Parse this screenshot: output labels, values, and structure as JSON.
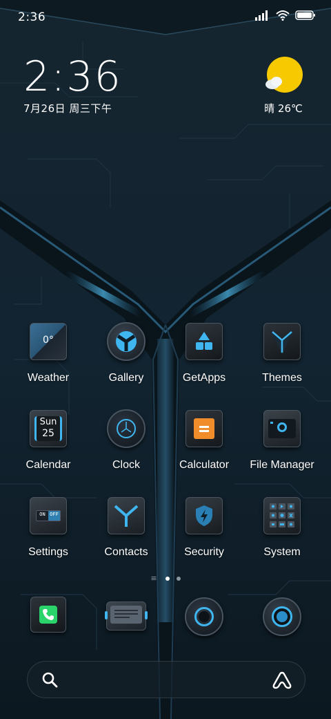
{
  "status_bar": {
    "time": "2:36",
    "icons": [
      "signal-icon",
      "wifi-icon",
      "battery-icon"
    ]
  },
  "clock_widget": {
    "time": "2:36",
    "date": "7月26日 周三下午"
  },
  "weather_widget": {
    "icon": "sun-cloud-icon",
    "text": "晴 26℃"
  },
  "apps": [
    {
      "label": "Weather",
      "icon": "weather-app-icon",
      "badge": "0°"
    },
    {
      "label": "Gallery",
      "icon": "gallery-app-icon"
    },
    {
      "label": "GetApps",
      "icon": "getapps-app-icon"
    },
    {
      "label": "Themes",
      "icon": "themes-app-icon"
    },
    {
      "label": "Calendar",
      "icon": "calendar-app-icon",
      "day_name": "Sun",
      "day_num": "25"
    },
    {
      "label": "Clock",
      "icon": "clock-app-icon"
    },
    {
      "label": "Calculator",
      "icon": "calculator-app-icon"
    },
    {
      "label": "File Manager",
      "icon": "file-manager-app-icon"
    },
    {
      "label": "Settings",
      "icon": "settings-app-icon",
      "toggle_on": "ON",
      "toggle_off": "OFF"
    },
    {
      "label": "Contacts",
      "icon": "contacts-app-icon"
    },
    {
      "label": "Security",
      "icon": "security-app-icon"
    },
    {
      "label": "System",
      "icon": "system-app-icon"
    }
  ],
  "page_indicator": {
    "pages": 2,
    "active": 0
  },
  "dock": [
    {
      "icon": "phone-app-icon"
    },
    {
      "icon": "messages-app-icon"
    },
    {
      "icon": "browser-app-icon"
    },
    {
      "icon": "camera-app-icon"
    }
  ],
  "search_bar": {
    "left_icon": "search-icon",
    "right_icon": "assistant-icon"
  },
  "colors": {
    "accent_blue": "#3fb6f0",
    "background": "#0f1d26",
    "sun": "#f7c900",
    "calculator_orange": "#f08c2a",
    "phone_green": "#2bd46b"
  }
}
